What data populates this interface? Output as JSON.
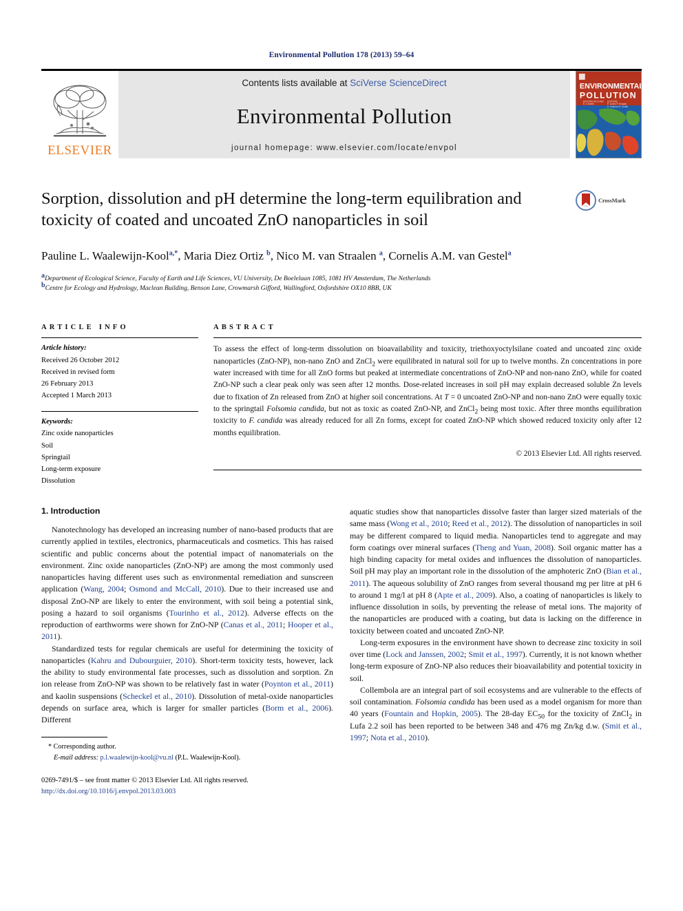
{
  "running_head": "Environmental Pollution 178 (2013) 59–64",
  "masthead": {
    "contents_prefix": "Contents lists available at ",
    "contents_link": "SciVerse ScienceDirect",
    "journal_name": "Environmental Pollution",
    "homepage": "journal homepage: www.elsevier.com/locate/envpol",
    "publisher_wordmark": "ELSEVIER",
    "cover_title_line1": "ENVIRONMENTAL",
    "cover_title_line2": "POLLUTION"
  },
  "title": "Sorption, dissolution and pH determine the long-term equilibration and toxicity of coated and uncoated ZnO nanoparticles in soil",
  "crossmark_label": "CrossMark",
  "authors_html": "Pauline L. Waalewijn-Kool<sup>a,*</sup>, Maria Diez Ortiz <sup>b</sup>, Nico M. van Straalen <sup>a</sup>, Cornelis A.M. van Gestel<sup>a</sup>",
  "affiliations": [
    {
      "marker": "a",
      "text": "Department of Ecological Science, Faculty of Earth and Life Sciences, VU University, De Boelelaan 1085, 1081 HV Amsterdam, The Netherlands"
    },
    {
      "marker": "b",
      "text": "Centre for Ecology and Hydrology, Maclean Building, Benson Lane, Crowmarsh Gifford, Wallingford, Oxfordshire OX10 8BB, UK"
    }
  ],
  "article_info": {
    "heading": "ARTICLE INFO",
    "history_label": "Article history:",
    "history_lines": [
      "Received 26 October 2012",
      "Received in revised form",
      "26 February 2013",
      "Accepted 1 March 2013"
    ],
    "keywords_label": "Keywords:",
    "keywords": [
      "Zinc oxide nanoparticles",
      "Soil",
      "Springtail",
      "Long-term exposure",
      "Dissolution"
    ]
  },
  "abstract": {
    "heading": "ABSTRACT",
    "text_html": "To assess the effect of long-term dissolution on bioavailability and toxicity, triethoxyoctylsilane coated and uncoated zinc oxide nanoparticles (ZnO-NP), non-nano ZnO and ZnCl<sub>2</sub> were equilibrated in natural soil for up to twelve months. Zn concentrations in pore water increased with time for all ZnO forms but peaked at intermediate concentrations of ZnO-NP and non-nano ZnO, while for coated ZnO-NP such a clear peak only was seen after 12 months. Dose-related increases in soil pH may explain decreased soluble Zn levels due to fixation of Zn released from ZnO at higher soil concentrations. At <i>T</i> = 0 uncoated ZnO-NP and non-nano ZnO were equally toxic to the springtail <i>Folsomia candida</i>, but not as toxic as coated ZnO-NP, and ZnCl<sub>2</sub> being most toxic. After three months equilibration toxicity to <i>F. candida</i> was already reduced for all Zn forms, except for coated ZnO-NP which showed reduced toxicity only after 12 months equilibration.",
    "copyright": "© 2013 Elsevier Ltd. All rights reserved."
  },
  "body": {
    "section_heading": "1. Introduction",
    "left_paragraphs_html": [
      "Nanotechnology has developed an increasing number of nano-based products that are currently applied in textiles, electronics, pharmaceuticals and cosmetics. This has raised scientific and public concerns about the potential impact of nanomaterials on the environment. Zinc oxide nanoparticles (ZnO-NP) are among the most commonly used nanoparticles having different uses such as environmental remediation and sunscreen application (<span class=\"cit\">Wang, 2004</span>; <span class=\"cit\">Osmond and McCall, 2010</span>). Due to their increased use and disposal ZnO-NP are likely to enter the environment, with soil being a potential sink, posing a hazard to soil organisms (<span class=\"cit\">Tourinho et al., 2012</span>). Adverse effects on the reproduction of earthworms were shown for ZnO-NP (<span class=\"cit\">Canas et al., 2011</span>; <span class=\"cit\">Hooper et al., 2011</span>).",
      "Standardized tests for regular chemicals are useful for determining the toxicity of nanoparticles (<span class=\"cit\">Kahru and Dubourguier, 2010</span>). Short-term toxicity tests, however, lack the ability to study environmental fate processes, such as dissolution and sorption. Zn ion release from ZnO-NP was shown to be relatively fast in water (<span class=\"cit\">Poynton et al., 2011</span>) and kaolin suspensions (<span class=\"cit\">Scheckel et al., 2010</span>). Dissolution of metal-oxide nanoparticles depends on surface area, which is larger for smaller particles (<span class=\"cit\">Borm et al., 2006</span>). Different"
    ],
    "right_paragraphs_html": [
      "aquatic studies show that nanoparticles dissolve faster than larger sized materials of the same mass (<span class=\"cit\">Wong et al., 2010</span>; <span class=\"cit\">Reed et al., 2012</span>). The dissolution of nanoparticles in soil may be different compared to liquid media. Nanoparticles tend to aggregate and may form coatings over mineral surfaces (<span class=\"cit\">Theng and Yuan, 2008</span>). Soil organic matter has a high binding capacity for metal oxides and influences the dissolution of nanoparticles. Soil pH may play an important role in the dissolution of the amphoteric ZnO (<span class=\"cit\">Bian et al., 2011</span>). The aqueous solubility of ZnO ranges from several thousand mg per litre at pH 6 to around 1 mg/l at pH 8 (<span class=\"cit\">Apte et al., 2009</span>). Also, a coating of nanoparticles is likely to influence dissolution in soils, by preventing the release of metal ions. The majority of the nanoparticles are produced with a coating, but data is lacking on the difference in toxicity between coated and uncoated ZnO-NP.",
      "Long-term exposures in the environment have shown to decrease zinc toxicity in soil over time (<span class=\"cit\">Lock and Janssen, 2002</span>; <span class=\"cit\">Smit et al., 1997</span>). Currently, it is not known whether long-term exposure of ZnO-NP also reduces their bioavailability and potential toxicity in soil.",
      "Collembola are an integral part of soil ecosystems and are vulnerable to the effects of soil contamination. <i>Folsomia candida</i> has been used as a model organism for more than 40 years (<span class=\"cit\">Fountain and Hopkin, 2005</span>). The 28-day EC<sub>50</sub> for the toxicity of ZnCl<sub>2</sub> in Lufa 2.2 soil has been reported to be between 348 and 476 mg Zn/kg d.w. (<span class=\"cit\">Smit et al., 1997</span>; <span class=\"cit\">Nota et al., 2010</span>)."
    ]
  },
  "footnotes": {
    "corresponding": "* Corresponding author.",
    "email_label": "E-mail address:",
    "email": "p.l.waalewijn-kool@vu.nl",
    "email_suffix": "(P.L. Waalewijn-Kool)."
  },
  "imprint": {
    "issn_line": "0269-7491/$ – see front matter © 2013 Elsevier Ltd. All rights reserved.",
    "doi": "http://dx.doi.org/10.1016/j.envpol.2013.03.003"
  },
  "colors": {
    "link_blue": "#1f3f8f",
    "sciencedirect_blue": "#3b5ca8",
    "elsevier_orange": "#ec7c24",
    "masthead_gray": "#e6e6e6"
  }
}
